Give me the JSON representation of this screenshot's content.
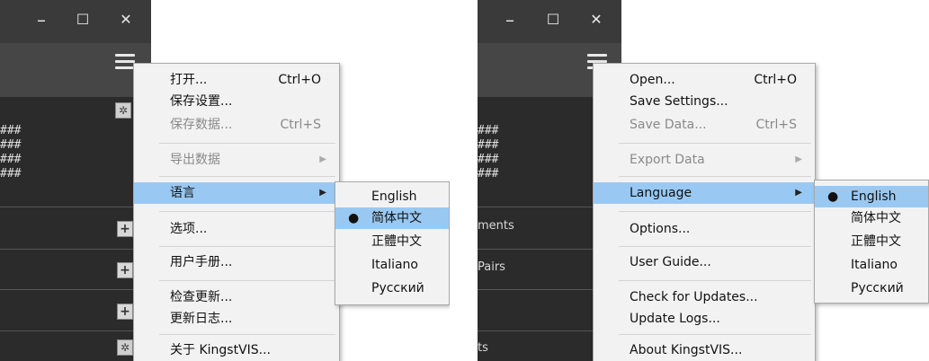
{
  "left": {
    "menu": {
      "open": {
        "label": "打开...",
        "shortcut": "Ctrl+O"
      },
      "save_settings": {
        "label": "保存设置..."
      },
      "save_data": {
        "label": "保存数据...",
        "shortcut": "Ctrl+S"
      },
      "export_data": {
        "label": "导出数据"
      },
      "language": {
        "label": "语言"
      },
      "options": {
        "label": "选项..."
      },
      "user_guide": {
        "label": "用户手册..."
      },
      "check_updates": {
        "label": "检查更新..."
      },
      "update_logs": {
        "label": "更新日志..."
      },
      "about": {
        "label": "关于 KingstVIS..."
      }
    },
    "languages": [
      "English",
      "简体中文",
      "正體中文",
      "Italiano",
      "Русский"
    ],
    "selected_language": 1,
    "hash_rows": [
      "###",
      "###",
      "###",
      "###"
    ]
  },
  "right": {
    "menu": {
      "open": {
        "label": "Open...",
        "shortcut": "Ctrl+O"
      },
      "save_settings": {
        "label": "Save Settings..."
      },
      "save_data": {
        "label": "Save Data...",
        "shortcut": "Ctrl+S"
      },
      "export_data": {
        "label": "Export Data"
      },
      "language": {
        "label": "Language"
      },
      "options": {
        "label": "Options..."
      },
      "user_guide": {
        "label": "User Guide..."
      },
      "check_updates": {
        "label": "Check for Updates..."
      },
      "update_logs": {
        "label": "Update Logs..."
      },
      "about": {
        "label": "About KingstVIS..."
      }
    },
    "languages": [
      "English",
      "简体中文",
      "正體中文",
      "Italiano",
      "Русский"
    ],
    "selected_language": 0,
    "hash_rows": [
      "###",
      "###",
      "###",
      "###"
    ],
    "row_labels": {
      "measurements": "ments",
      "pairs": "Pairs",
      "ts": "ts"
    }
  },
  "window_controls": {
    "minimize": "–",
    "maximize": "☐",
    "close": "✕"
  },
  "bullet": "●",
  "submenu_arrow": "▶",
  "plus": "+",
  "gear": "✲"
}
